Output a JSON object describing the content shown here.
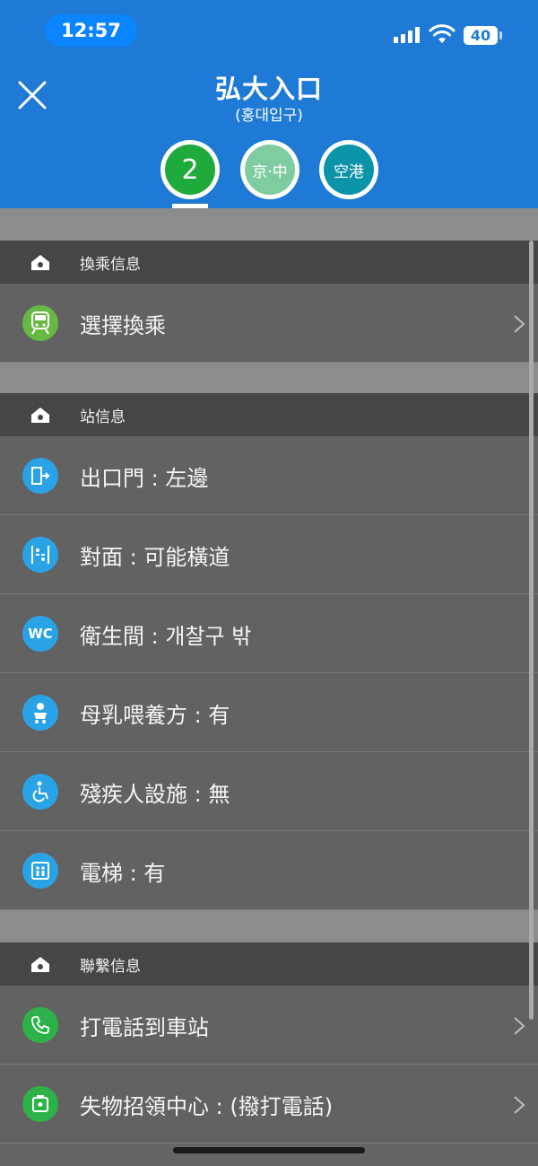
{
  "status_bar": {
    "time": "12:57",
    "battery": "40"
  },
  "header": {
    "title": "弘大入口",
    "subtitle": "(홍대입구)",
    "lines": [
      {
        "label": "2",
        "color": "#1faa3c"
      },
      {
        "label": "京·中",
        "color": "#7fcca1"
      },
      {
        "label": "空港",
        "color": "#0b93a8"
      }
    ]
  },
  "sections": {
    "transfer": {
      "title": "換乘信息",
      "items": [
        {
          "label": "選擇換乘",
          "icon": "train-icon"
        }
      ]
    },
    "station": {
      "title": "站信息",
      "items": [
        {
          "label": "出口門 : 左邊",
          "icon": "exit-door-icon"
        },
        {
          "label": "對面 : 可能橫道",
          "icon": "opposite-side-icon"
        },
        {
          "label": "衛生間 : 개찰구 밖",
          "icon": "wc-icon",
          "icon_text": "WC"
        },
        {
          "label": "母乳喂養方 : 有",
          "icon": "nursing-room-icon"
        },
        {
          "label": "殘疾人設施 : 無",
          "icon": "wheelchair-icon"
        },
        {
          "label": "電梯 : 有",
          "icon": "elevator-icon"
        }
      ]
    },
    "contact": {
      "title": "聯繫信息",
      "items": [
        {
          "label": "打電話到車站",
          "icon": "phone-icon"
        },
        {
          "label": "失物招領中心 : (撥打電話)",
          "icon": "lost-and-found-icon"
        }
      ]
    }
  }
}
